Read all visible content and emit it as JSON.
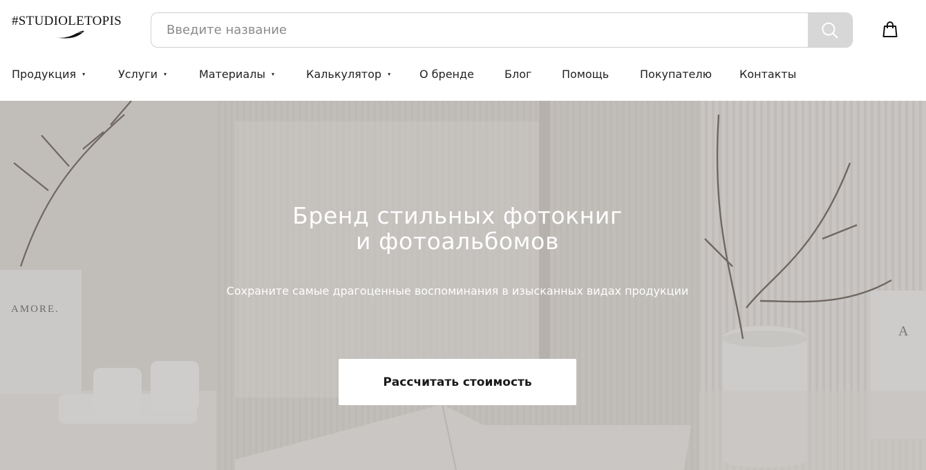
{
  "header": {
    "logo_text": "#STUDIOLETOPIS",
    "search": {
      "placeholder": "Введите название"
    },
    "icons": {
      "search": "search-icon",
      "cart": "shopping-bag-icon",
      "logo": "feather-icon"
    }
  },
  "nav": {
    "items": [
      {
        "label": "Продукция",
        "dropdown": true
      },
      {
        "label": "Услуги",
        "dropdown": true
      },
      {
        "label": "Материалы",
        "dropdown": true
      },
      {
        "label": "Калькулятор",
        "dropdown": true
      },
      {
        "label": "О бренде",
        "dropdown": false
      },
      {
        "label": "Блог",
        "dropdown": false
      },
      {
        "label": "Помощь",
        "dropdown": false
      },
      {
        "label": "Покупателю",
        "dropdown": false
      },
      {
        "label": "Контакты",
        "dropdown": false
      }
    ],
    "dropdown_marker": "▾"
  },
  "hero": {
    "title_line1": "Бренд стильных фотокниг",
    "title_line2": "и фотоальбомов",
    "subtitle": "Сохраните самые драгоценные воспоминания в изысканных видах продукции",
    "cta_label": "Рассчитать стоимость",
    "scene_text": {
      "left_card": "AMORE.",
      "right_card": "A"
    }
  },
  "colors": {
    "overlay": "#8f8b87",
    "search_button": "#d7d7d7",
    "text_dark": "#222222",
    "hero_bg": "#d6d3cf"
  }
}
